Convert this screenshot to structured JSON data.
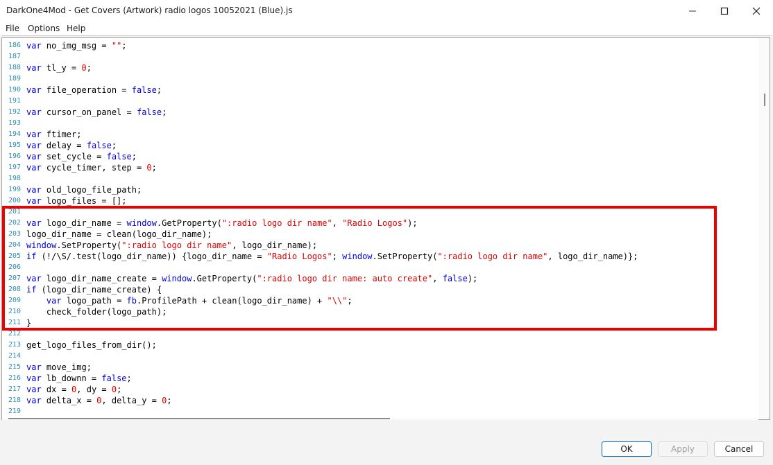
{
  "window": {
    "title": "DarkOne4Mod - Get Covers (Artwork) radio logos 10052021 (Blue).js"
  },
  "menu": [
    "File",
    "Options",
    "Help"
  ],
  "code_lines": [
    {
      "n": "186",
      "tokens": [
        [
          "kw",
          "var"
        ],
        [
          "p",
          " no_img_msg = "
        ],
        [
          "str",
          "\"\""
        ],
        [
          "p",
          ";"
        ]
      ]
    },
    {
      "n": "187",
      "tokens": []
    },
    {
      "n": "188",
      "tokens": [
        [
          "kw",
          "var"
        ],
        [
          "p",
          " tl_y = "
        ],
        [
          "num",
          "0"
        ],
        [
          "p",
          ";"
        ]
      ]
    },
    {
      "n": "189",
      "tokens": []
    },
    {
      "n": "190",
      "tokens": [
        [
          "kw",
          "var"
        ],
        [
          "p",
          " file_operation = "
        ],
        [
          "kw",
          "false"
        ],
        [
          "p",
          ";"
        ]
      ]
    },
    {
      "n": "191",
      "tokens": []
    },
    {
      "n": "192",
      "tokens": [
        [
          "kw",
          "var"
        ],
        [
          "p",
          " cursor_on_panel = "
        ],
        [
          "kw",
          "false"
        ],
        [
          "p",
          ";"
        ]
      ]
    },
    {
      "n": "193",
      "tokens": []
    },
    {
      "n": "194",
      "tokens": [
        [
          "kw",
          "var"
        ],
        [
          "p",
          " ftimer;"
        ]
      ]
    },
    {
      "n": "195",
      "tokens": [
        [
          "kw",
          "var"
        ],
        [
          "p",
          " delay = "
        ],
        [
          "kw",
          "false"
        ],
        [
          "p",
          ";"
        ]
      ]
    },
    {
      "n": "196",
      "tokens": [
        [
          "kw",
          "var"
        ],
        [
          "p",
          " set_cycle = "
        ],
        [
          "kw",
          "false"
        ],
        [
          "p",
          ";"
        ]
      ]
    },
    {
      "n": "197",
      "tokens": [
        [
          "kw",
          "var"
        ],
        [
          "p",
          " cycle_timer, step = "
        ],
        [
          "num",
          "0"
        ],
        [
          "p",
          ";"
        ]
      ]
    },
    {
      "n": "198",
      "tokens": []
    },
    {
      "n": "199",
      "tokens": [
        [
          "kw",
          "var"
        ],
        [
          "p",
          " old_logo_file_path;"
        ]
      ]
    },
    {
      "n": "200",
      "tokens": [
        [
          "kw",
          "var"
        ],
        [
          "p",
          " logo_files = [];"
        ]
      ]
    },
    {
      "n": "201",
      "tokens": []
    },
    {
      "n": "202",
      "tokens": [
        [
          "kw",
          "var"
        ],
        [
          "p",
          " logo_dir_name = "
        ],
        [
          "obj",
          "window"
        ],
        [
          "p",
          ".GetProperty("
        ],
        [
          "str",
          "\":radio logo dir name\""
        ],
        [
          "p",
          ", "
        ],
        [
          "str",
          "\"Radio Logos\""
        ],
        [
          "p",
          ");"
        ]
      ]
    },
    {
      "n": "203",
      "tokens": [
        [
          "p",
          "logo_dir_name = clean(logo_dir_name);"
        ]
      ]
    },
    {
      "n": "204",
      "tokens": [
        [
          "obj",
          "window"
        ],
        [
          "p",
          ".SetProperty("
        ],
        [
          "str",
          "\":radio logo dir name\""
        ],
        [
          "p",
          ", logo_dir_name);"
        ]
      ]
    },
    {
      "n": "205",
      "tokens": [
        [
          "kw",
          "if"
        ],
        [
          "p",
          " (!/\\S/.test(logo_dir_name)) {logo_dir_name = "
        ],
        [
          "str",
          "\"Radio Logos\""
        ],
        [
          "p",
          "; "
        ],
        [
          "obj",
          "window"
        ],
        [
          "p",
          ".SetProperty("
        ],
        [
          "str",
          "\":radio logo dir name\""
        ],
        [
          "p",
          ", logo_dir_name)};"
        ]
      ]
    },
    {
      "n": "206",
      "tokens": []
    },
    {
      "n": "207",
      "tokens": [
        [
          "kw",
          "var"
        ],
        [
          "p",
          " logo_dir_name_create = "
        ],
        [
          "obj",
          "window"
        ],
        [
          "p",
          ".GetProperty("
        ],
        [
          "str",
          "\":radio logo dir name: auto create\""
        ],
        [
          "p",
          ", "
        ],
        [
          "kw",
          "false"
        ],
        [
          "p",
          ");"
        ]
      ]
    },
    {
      "n": "208",
      "tokens": [
        [
          "kw",
          "if"
        ],
        [
          "p",
          " (logo_dir_name_create) {"
        ]
      ]
    },
    {
      "n": "209",
      "tokens": [
        [
          "p",
          "    "
        ],
        [
          "kw",
          "var"
        ],
        [
          "p",
          " logo_path = "
        ],
        [
          "obj",
          "fb"
        ],
        [
          "p",
          ".ProfilePath + clean(logo_dir_name) + "
        ],
        [
          "str",
          "\"\\\\\""
        ],
        [
          "p",
          ";"
        ]
      ]
    },
    {
      "n": "210",
      "tokens": [
        [
          "p",
          "    check_folder(logo_path);"
        ]
      ]
    },
    {
      "n": "211",
      "tokens": [
        [
          "p",
          "}"
        ]
      ]
    },
    {
      "n": "212",
      "tokens": []
    },
    {
      "n": "213",
      "tokens": [
        [
          "p",
          "get_logo_files_from_dir();"
        ]
      ]
    },
    {
      "n": "214",
      "tokens": []
    },
    {
      "n": "215",
      "tokens": [
        [
          "kw",
          "var"
        ],
        [
          "p",
          " move_img;"
        ]
      ]
    },
    {
      "n": "216",
      "tokens": [
        [
          "kw",
          "var"
        ],
        [
          "p",
          " lb_downn = "
        ],
        [
          "kw",
          "false"
        ],
        [
          "p",
          ";"
        ]
      ]
    },
    {
      "n": "217",
      "tokens": [
        [
          "kw",
          "var"
        ],
        [
          "p",
          " dx = "
        ],
        [
          "num",
          "0"
        ],
        [
          "p",
          ", dy = "
        ],
        [
          "num",
          "0"
        ],
        [
          "p",
          ";"
        ]
      ]
    },
    {
      "n": "218",
      "tokens": [
        [
          "kw",
          "var"
        ],
        [
          "p",
          " delta_x = "
        ],
        [
          "num",
          "0"
        ],
        [
          "p",
          ", delta_y = "
        ],
        [
          "num",
          "0"
        ],
        [
          "p",
          ";"
        ]
      ]
    },
    {
      "n": "219",
      "tokens": []
    }
  ],
  "buttons": {
    "ok": "OK",
    "apply": "Apply",
    "cancel": "Cancel"
  },
  "colors": {
    "keyword": "#0000dd",
    "string": "#dd0000",
    "line_number": "#2b8db0",
    "highlight_border": "#ee0000"
  },
  "icons": {
    "minimize": "minimize-icon",
    "maximize": "maximize-icon",
    "close": "close-icon"
  }
}
